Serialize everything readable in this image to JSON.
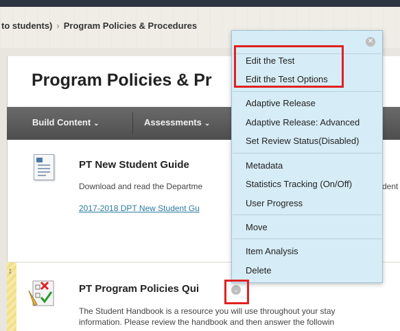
{
  "breadcrumb": {
    "parent": "to students)",
    "separator": "›",
    "current": "Program Policies & Procedures"
  },
  "page": {
    "title": "Program Policies & Pr"
  },
  "action_bar": {
    "build_content": "Build Content",
    "assessments": "Assessments",
    "chevron": "⌄"
  },
  "items": [
    {
      "title": "PT New Student Guide",
      "desc": "Download and read the Departme",
      "desc_tail": "dent",
      "link": "2017-2018 DPT New Student Gu"
    },
    {
      "title": "PT Program Policies Qui",
      "desc_line1": "The Student Handbook is a resource you will use throughout your stay",
      "desc_line2": "information. Please review the handbook and then answer the followin"
    }
  ],
  "drag_glyph": "↕",
  "menu": {
    "close_glyph": "✕",
    "items": [
      "Edit the Test",
      "Edit the Test Options",
      "Adaptive Release",
      "Adaptive Release: Advanced",
      "Set Review Status(Disabled)",
      "Metadata",
      "Statistics Tracking (On/Off)",
      "User Progress",
      "Move",
      "Item Analysis",
      "Delete"
    ]
  },
  "chevron_glyph": "⌄",
  "colors": {
    "highlight": "#e02020",
    "menu_bg": "#d6ecf6",
    "link": "#2a7a9e"
  }
}
